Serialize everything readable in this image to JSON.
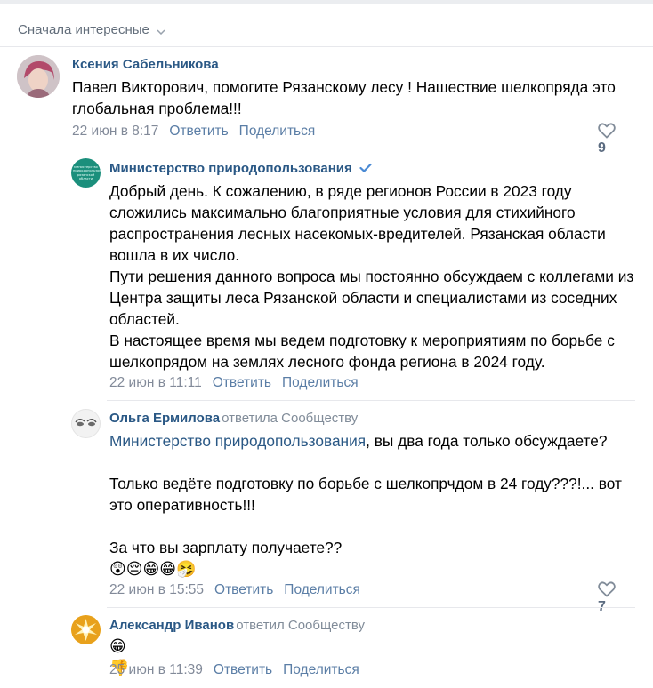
{
  "sort": {
    "label": "Сначала интересные"
  },
  "comments": [
    {
      "author": "Ксения Сабельникова",
      "text": "Павел Викторович, помогите Рязанскому лесу ! Нашествие шелкопряда это глобальная проблема!!!",
      "time": "22 июн в 8:17",
      "reply_label": "Ответить",
      "share_label": "Поделиться",
      "likes": "9"
    },
    {
      "author": "Министерство природопользования",
      "avatar_text": "министерство природопользования рязанской области",
      "paragraphs": [
        "Добрый день. К сожалению, в ряде регионов России в 2023 году сложились максимально благоприятные условия для стихийного распространения лесных насекомых-вредителей. Рязанская области вошла в их число.",
        "Пути решения данного вопроса мы постоянно обсуждаем с коллегами из Центра защиты леса Рязанской области и специалистами из соседних областей.",
        "В настоящее время мы ведем подготовку к мероприятиям по борьбе с шелкопрядом на землях лесного фонда региона в 2024 году."
      ],
      "time": "22 июн в 11:11",
      "reply_label": "Ответить",
      "share_label": "Поделиться"
    },
    {
      "author": "Ольга Ермилова",
      "replied": "ответила Сообществу",
      "mention": "Министерство природопользования",
      "line1_rest": ", вы два года только обсуждаете?",
      "line2": "Только ведёте подготовку по борьбе с шелкопрчдом в 24 году???!... вот это оперативность!!!",
      "line3": "За что вы зарплату получаете??",
      "emojis": "😲😔😁😁🤧",
      "time": "22 июн в 15:55",
      "reply_label": "Ответить",
      "share_label": "Поделиться",
      "likes": "7"
    },
    {
      "author": "Александр Иванов",
      "replied": "ответил Сообществу",
      "emojis": "😁👎",
      "time": "25 июн в 11:39",
      "reply_label": "Ответить",
      "share_label": "Поделиться"
    }
  ],
  "colors": {
    "link": "#2a5885",
    "meta": "#828a99",
    "action": "#5b7ea6",
    "ministry_green": "#1b8f7c"
  }
}
